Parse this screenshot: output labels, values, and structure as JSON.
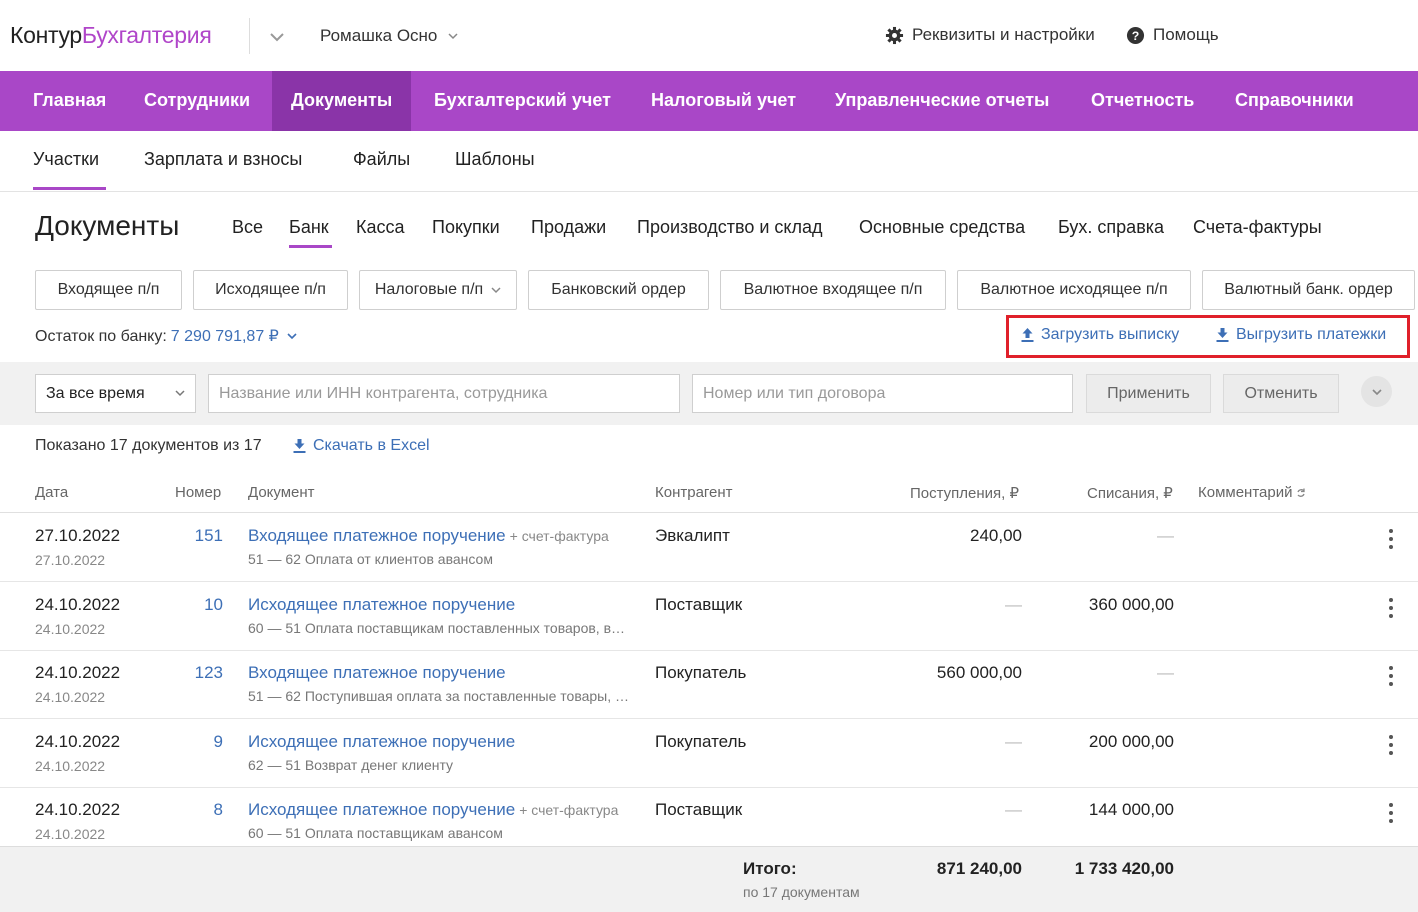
{
  "header": {
    "logo_main": "Контур",
    "logo_product": "Бухгалтерия",
    "org_name": "Ромашка Осно",
    "settings_label": "Реквизиты и настройки",
    "help_label": "Помощь"
  },
  "main_nav": [
    "Главная",
    "Сотрудники",
    "Документы",
    "Бухгалтерский учет",
    "Налоговый учет",
    "Управленческие отчеты",
    "Отчетность",
    "Справочники"
  ],
  "main_nav_active": "Документы",
  "sub_nav": [
    "Участки",
    "Зарплата и взносы",
    "Файлы",
    "Шаблоны"
  ],
  "sub_nav_active": "Участки",
  "page": {
    "title": "Документы",
    "tabs": [
      "Все",
      "Банк",
      "Касса",
      "Покупки",
      "Продажи",
      "Производство и склад",
      "Основные средства",
      "Бух. справка",
      "Счета-фактуры"
    ],
    "active_tab": "Банк"
  },
  "actions": [
    "Входящее п/п",
    "Исходящее п/п",
    "Налоговые п/п",
    "Банковский ордер",
    "Валютное входящее п/п",
    "Валютное исходящее п/п",
    "Валютный банк. ордер"
  ],
  "balance": {
    "label": "Остаток по банку:",
    "value": "7 290 791,87 ₽"
  },
  "links": {
    "upload": "Загрузить выписку",
    "download": "Выгрузить платежки",
    "excel": "Скачать в Excel"
  },
  "filters": {
    "period": "За все время",
    "contractor_placeholder": "Название или ИНН контрагента, сотрудника",
    "contract_placeholder": "Номер или тип договора",
    "apply": "Применить",
    "cancel": "Отменить"
  },
  "shown_text": "Показано 17 документов из 17",
  "table": {
    "headers": {
      "date": "Дата",
      "number": "Номер",
      "document": "Документ",
      "contractor": "Контрагент",
      "income": "Поступления, ₽",
      "outcome": "Списания, ₽",
      "comment": "Комментарий"
    },
    "rows": [
      {
        "date": "27.10.2022",
        "date2": "27.10.2022",
        "number": "151",
        "doc": "Входящее платежное поручение",
        "extra": "+ счет-фактура",
        "desc": "51 — 62 Оплата от клиентов авансом",
        "contractor": "Эвкалипт",
        "income": "240,00",
        "outcome": "—"
      },
      {
        "date": "24.10.2022",
        "date2": "24.10.2022",
        "number": "10",
        "doc": "Исходящее платежное поручение",
        "extra": "",
        "desc": "60 — 51 Оплата поставщикам поставленных товаров, вы...",
        "contractor": "Поставщик",
        "income": "—",
        "outcome": "360 000,00"
      },
      {
        "date": "24.10.2022",
        "date2": "24.10.2022",
        "number": "123",
        "doc": "Входящее платежное поручение",
        "extra": "",
        "desc": "51 — 62 Поступившая оплата за поставленные товары, в...",
        "contractor": "Покупатель",
        "income": "560 000,00",
        "outcome": "—"
      },
      {
        "date": "24.10.2022",
        "date2": "24.10.2022",
        "number": "9",
        "doc": "Исходящее платежное поручение",
        "extra": "",
        "desc": "62 — 51 Возврат денег клиенту",
        "contractor": "Покупатель",
        "income": "—",
        "outcome": "200 000,00"
      },
      {
        "date": "24.10.2022",
        "date2": "24.10.2022",
        "number": "8",
        "doc": "Исходящее платежное поручение",
        "extra": "+ счет-фактура",
        "desc": "60 — 51 Оплата поставщикам авансом",
        "contractor": "Поставщик",
        "income": "—",
        "outcome": "144 000,00"
      }
    ]
  },
  "totals": {
    "label": "Итого:",
    "sub": "по 17 документам",
    "income": "871 240,00",
    "outcome": "1 733 420,00"
  },
  "colors": {
    "brand": "#a947c7",
    "brand_active": "#8a34a8",
    "link": "#3d6fb6",
    "highlight": "#e0202a"
  }
}
